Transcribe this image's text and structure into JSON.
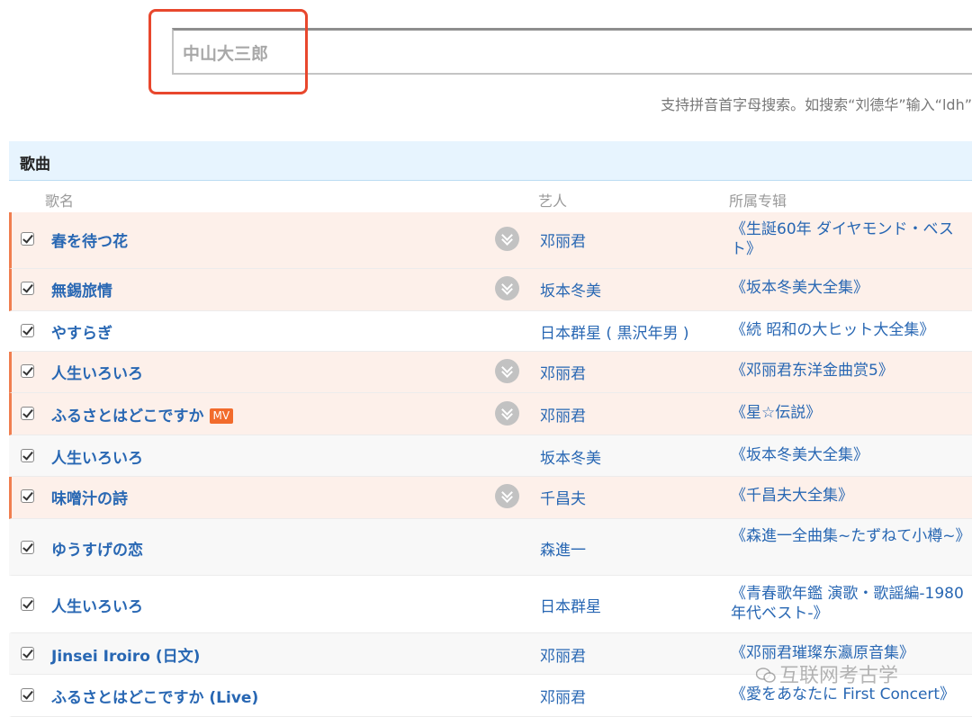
{
  "search": {
    "value": "中山大三郎",
    "hint": "支持拼音首字母搜索。如搜索“刘德华”输入“ldh”"
  },
  "section": {
    "title": "歌曲"
  },
  "columns": {
    "song": "歌名",
    "artist": "艺人",
    "album": "所属专辑"
  },
  "rows": [
    {
      "song": "春を待つ花",
      "artist": "邓丽君",
      "album": "《生誕60年 ダイヤモンド・ベスト》",
      "playing": true,
      "more": true
    },
    {
      "song": "無錫旅情",
      "artist": "坂本冬美",
      "album": "《坂本冬美大全集》",
      "playing": true,
      "more": true
    },
    {
      "song": "やすらぎ",
      "artist": "日本群星 ( 黒沢年男 )",
      "album": "《続 昭和の大ヒット大全集》",
      "playing": false,
      "more": false
    },
    {
      "song": "人生いろいろ",
      "artist": "邓丽君",
      "album": "《邓丽君东洋金曲赏5》",
      "playing": true,
      "more": true
    },
    {
      "song": "ふるさとはどこですか",
      "mv": "MV",
      "artist": "邓丽君",
      "album": "《星☆伝説》",
      "playing": true,
      "more": true
    },
    {
      "song": "人生いろいろ",
      "artist": "坂本冬美",
      "album": "《坂本冬美大全集》",
      "playing": false,
      "more": false
    },
    {
      "song": "味噌汁の詩",
      "artist": "千昌夫",
      "album": "《千昌夫大全集》",
      "playing": true,
      "more": true
    },
    {
      "song": "ゆうすげの恋",
      "artist": "森進一",
      "album": "《森進一全曲集~たずねて小樽~》",
      "playing": false,
      "more": false
    },
    {
      "song": "人生いろいろ",
      "artist": "日本群星",
      "album": "《青春歌年鑑 演歌・歌謡編-1980年代ベスト-》",
      "playing": false,
      "more": false
    },
    {
      "song": "Jinsei Iroiro (日文)",
      "artist": "邓丽君",
      "album": "《邓丽君璀璨东瀛原音集》",
      "playing": false,
      "more": false
    },
    {
      "song": "ふるさとはどこですか (Live)",
      "artist": "邓丽君",
      "album": "《愛をあなたに First Concert》",
      "playing": false,
      "more": false
    }
  ],
  "watermark": {
    "text": "互联网考古学",
    "icon": "wechat-icon"
  }
}
